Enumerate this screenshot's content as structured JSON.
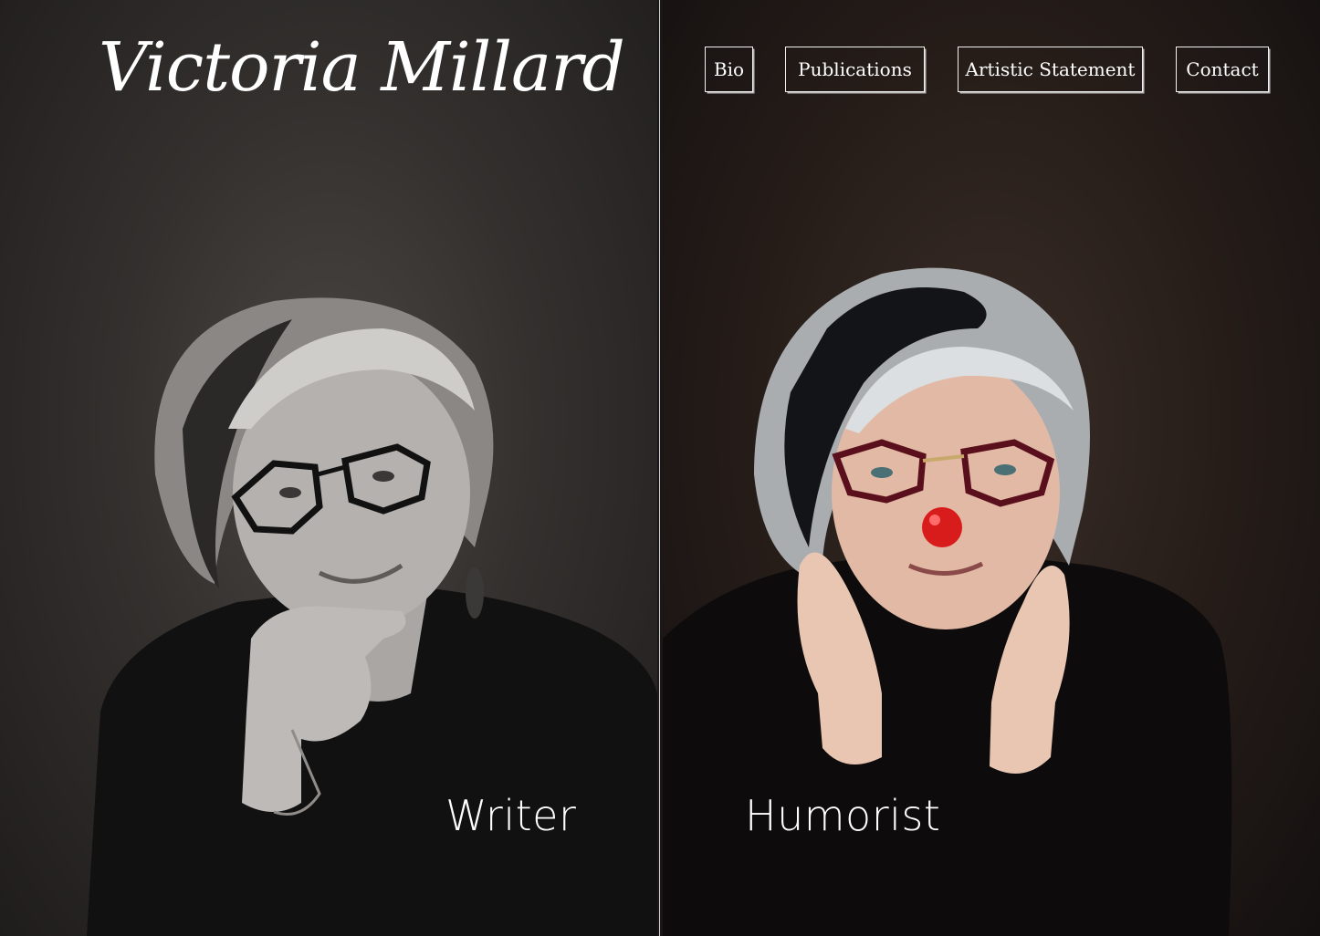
{
  "site": {
    "title": "Victoria Millard"
  },
  "nav": {
    "items": [
      {
        "label": "Bio"
      },
      {
        "label": "Publications"
      },
      {
        "label": "Artistic Statement"
      },
      {
        "label": "Contact"
      }
    ]
  },
  "panels": {
    "left": {
      "caption": "Writer"
    },
    "right": {
      "caption": "Humorist"
    }
  },
  "colors": {
    "background": "#2a2624",
    "text": "#ffffff",
    "nose_accent": "#d81b1b",
    "glasses_right": "#5a0f1c"
  }
}
